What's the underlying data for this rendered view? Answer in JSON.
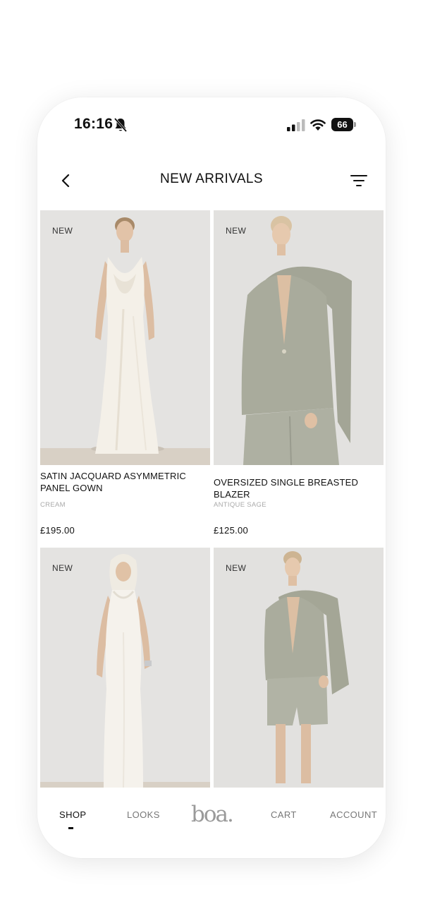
{
  "status_bar": {
    "time": "16:16",
    "battery": "66"
  },
  "header": {
    "title": "NEW ARRIVALS"
  },
  "products": [
    {
      "badge": "NEW",
      "name": "SATIN JACQUARD ASYMMETRIC PANEL GOWN",
      "color": "CREAM",
      "price": "£195.00"
    },
    {
      "badge": "NEW",
      "name": "OVERSIZED SINGLE BREASTED BLAZER",
      "color": "ANTIQUE SAGE",
      "price": "£125.00"
    },
    {
      "badge": "NEW"
    },
    {
      "badge": "NEW"
    }
  ],
  "nav": {
    "shop": "SHOP",
    "looks": "LOOKS",
    "logo": "boa.",
    "cart": "CART",
    "account": "ACCOUNT"
  },
  "colors": {
    "image_background": "#e2e1df",
    "cream": "#f3efe6",
    "sage": "#a9ab9c",
    "text": "#111111",
    "muted": "#aaaaaa"
  }
}
